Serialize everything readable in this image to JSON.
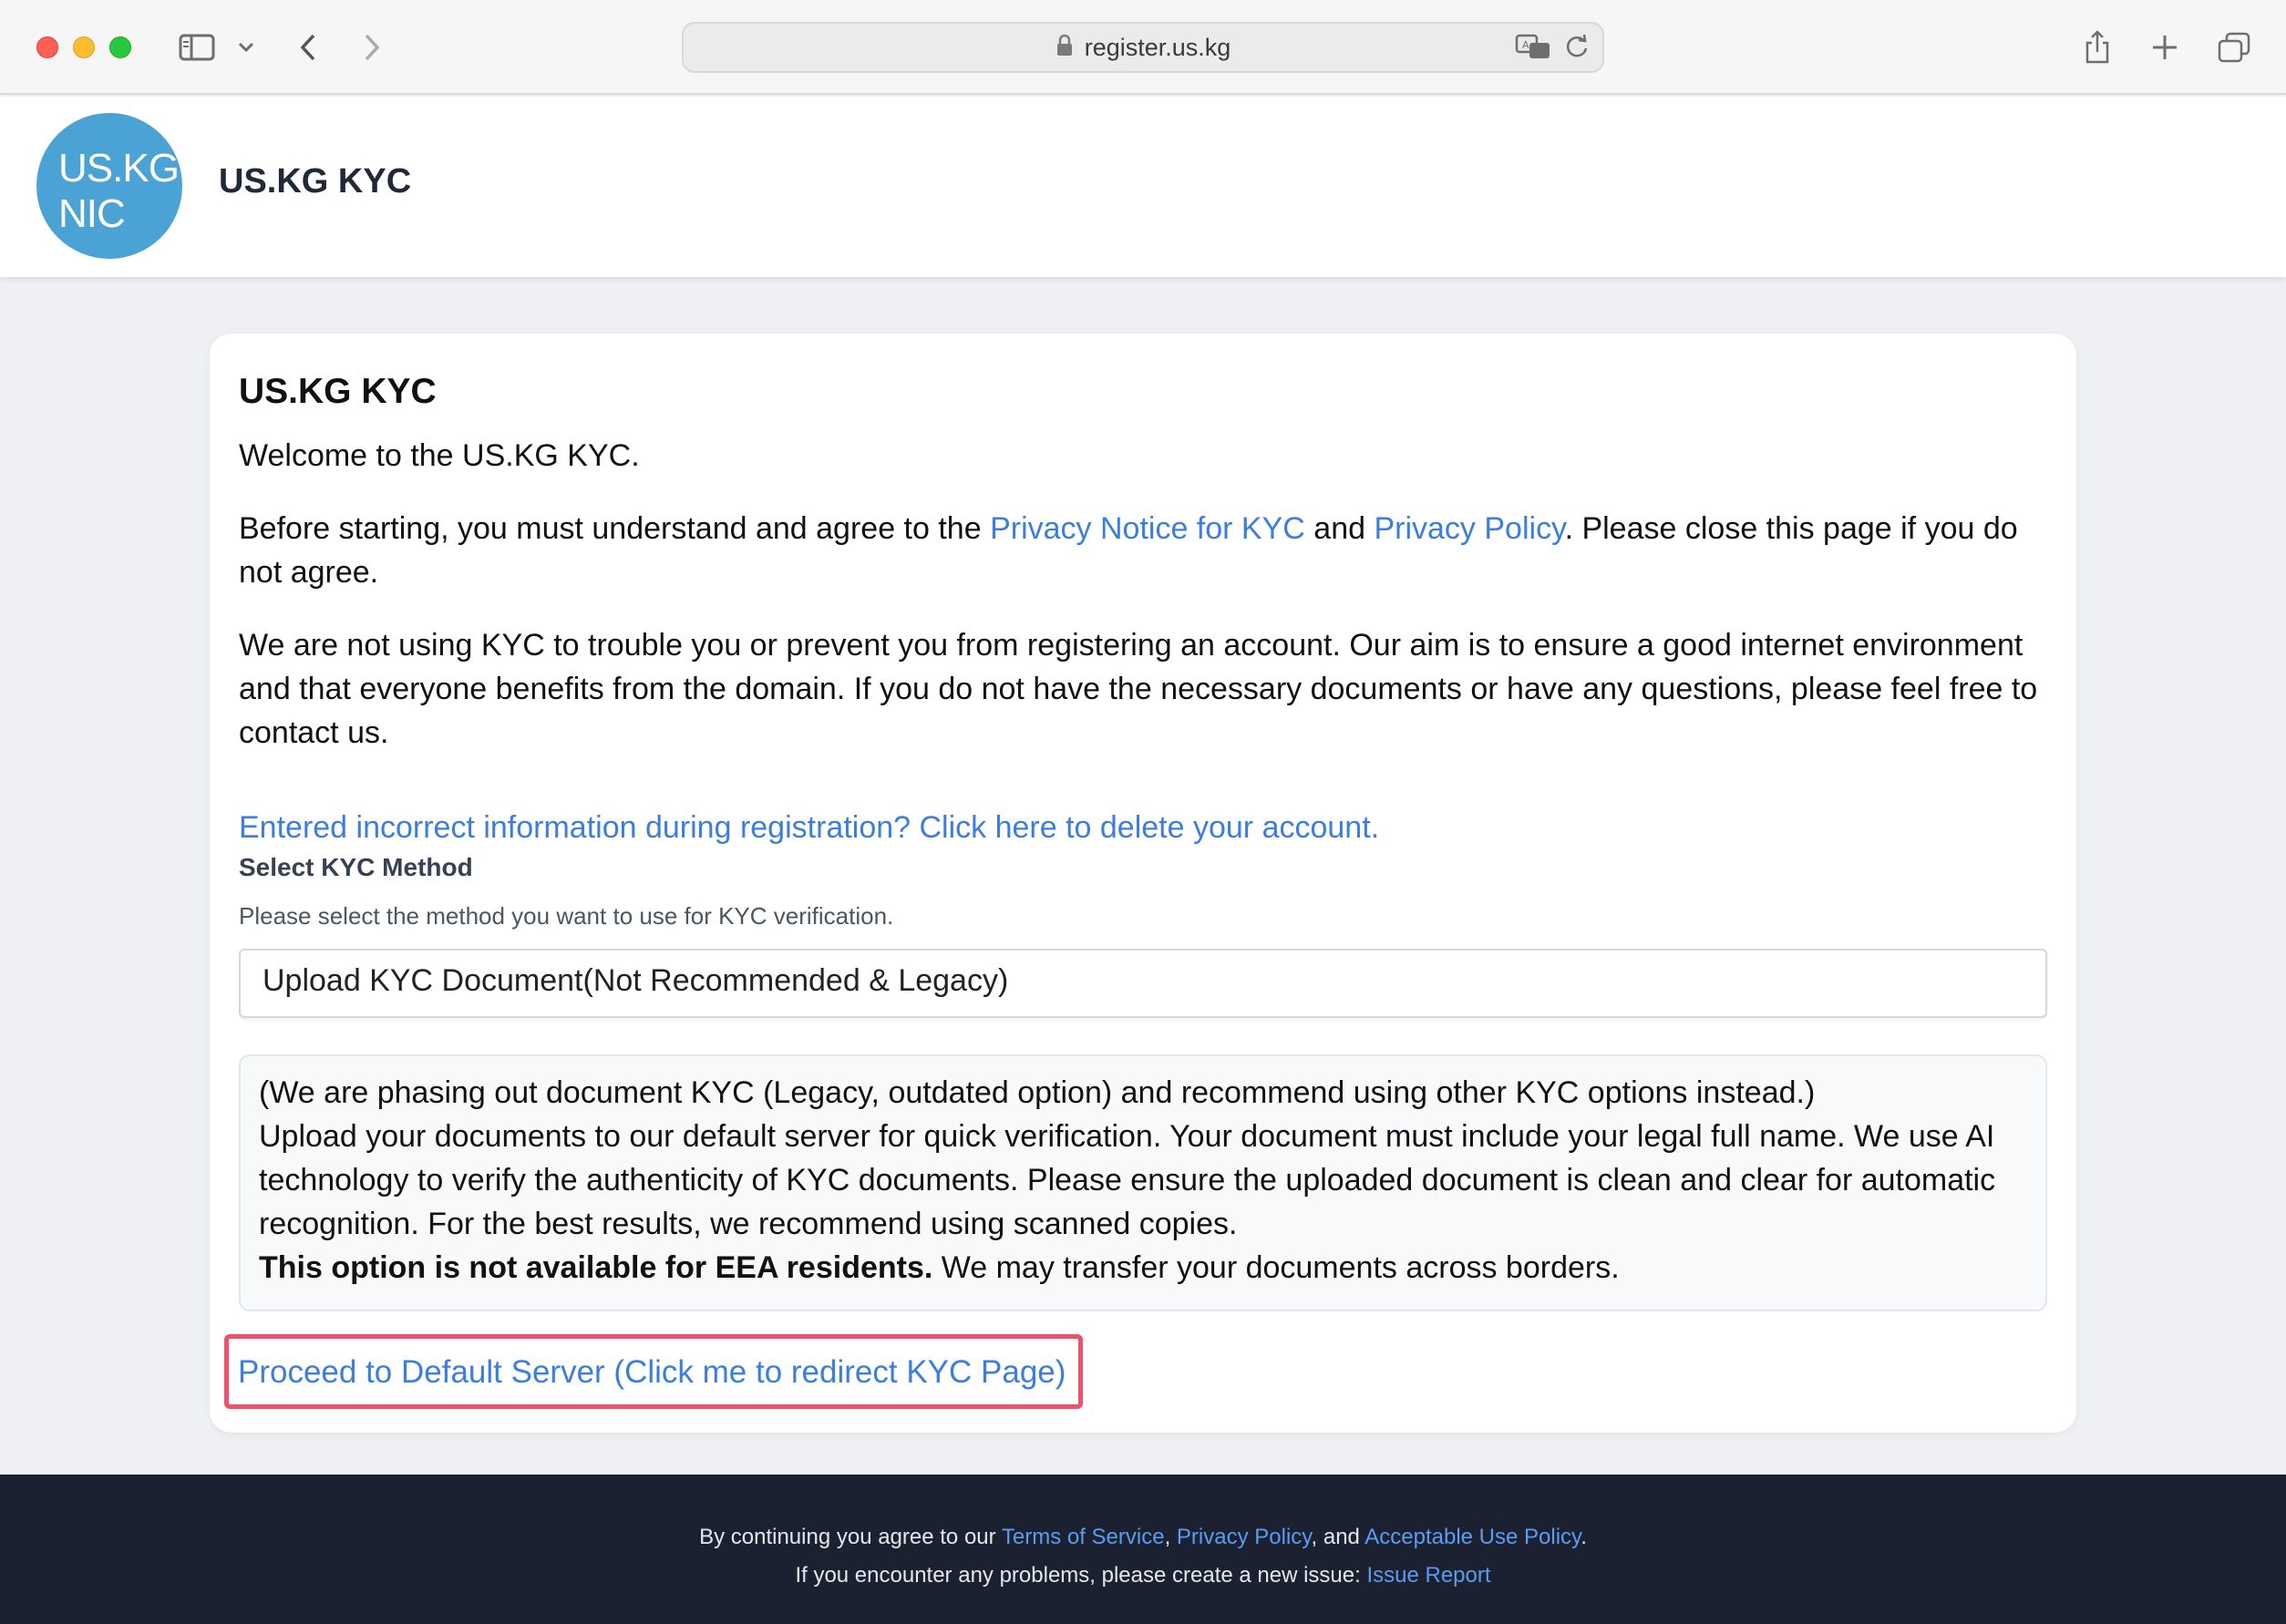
{
  "browser": {
    "url": "register.us.kg"
  },
  "header": {
    "logo_line1": "US.KG",
    "logo_line2": "NIC",
    "title": "US.KG KYC"
  },
  "card": {
    "title": "US.KG KYC",
    "welcome": "Welcome to the US.KG KYC.",
    "agree_before": "Before starting, you must understand and agree to the ",
    "privacy_notice_link": "Privacy Notice for KYC",
    "agree_and": " and ",
    "privacy_policy_link": "Privacy Policy",
    "agree_after": ". Please close this page if you do not agree.",
    "aim": "We are not using KYC to trouble you or prevent you from registering an account. Our aim is to ensure a good internet environment and that everyone benefits from the domain. If you do not have the necessary documents or have any questions, please feel free to contact us.",
    "delete_link": "Entered incorrect information during registration? Click here to delete your account.",
    "method_label": "Select KYC Method",
    "method_help": "Please select the method you want to use for KYC verification.",
    "method_selected": "Upload KYC Document(Not Recommended & Legacy)",
    "info_line1": "(We are phasing out document KYC (Legacy, outdated option) and recommend using other KYC options instead.)",
    "info_body": "Upload your documents to our default server for quick verification. Your document must include your legal full name. We use AI technology to verify the authenticity of KYC documents. Please ensure the uploaded document is clean and clear for automatic recognition. For the best results, we recommend using scanned copies.",
    "info_bold": "This option is not available for EEA residents.",
    "info_tail": " We may transfer your documents across borders.",
    "proceed_link": "Proceed to Default Server (Click me to redirect KYC Page)"
  },
  "footer": {
    "line1_prefix": "By continuing you agree to our ",
    "tos_link": "Terms of Service",
    "comma": ", ",
    "privacy_link": "Privacy Policy",
    "and": ", and ",
    "aup_link": "Acceptable Use Policy",
    "period": ".",
    "line2_prefix": "If you encounter any problems, please create a new issue: ",
    "issue_link": "Issue Report"
  },
  "colors": {
    "link": "#3b7ee0",
    "logo": "#4aa3d4",
    "highlight_border": "#f0506b",
    "footer_bg": "#1b2130"
  }
}
